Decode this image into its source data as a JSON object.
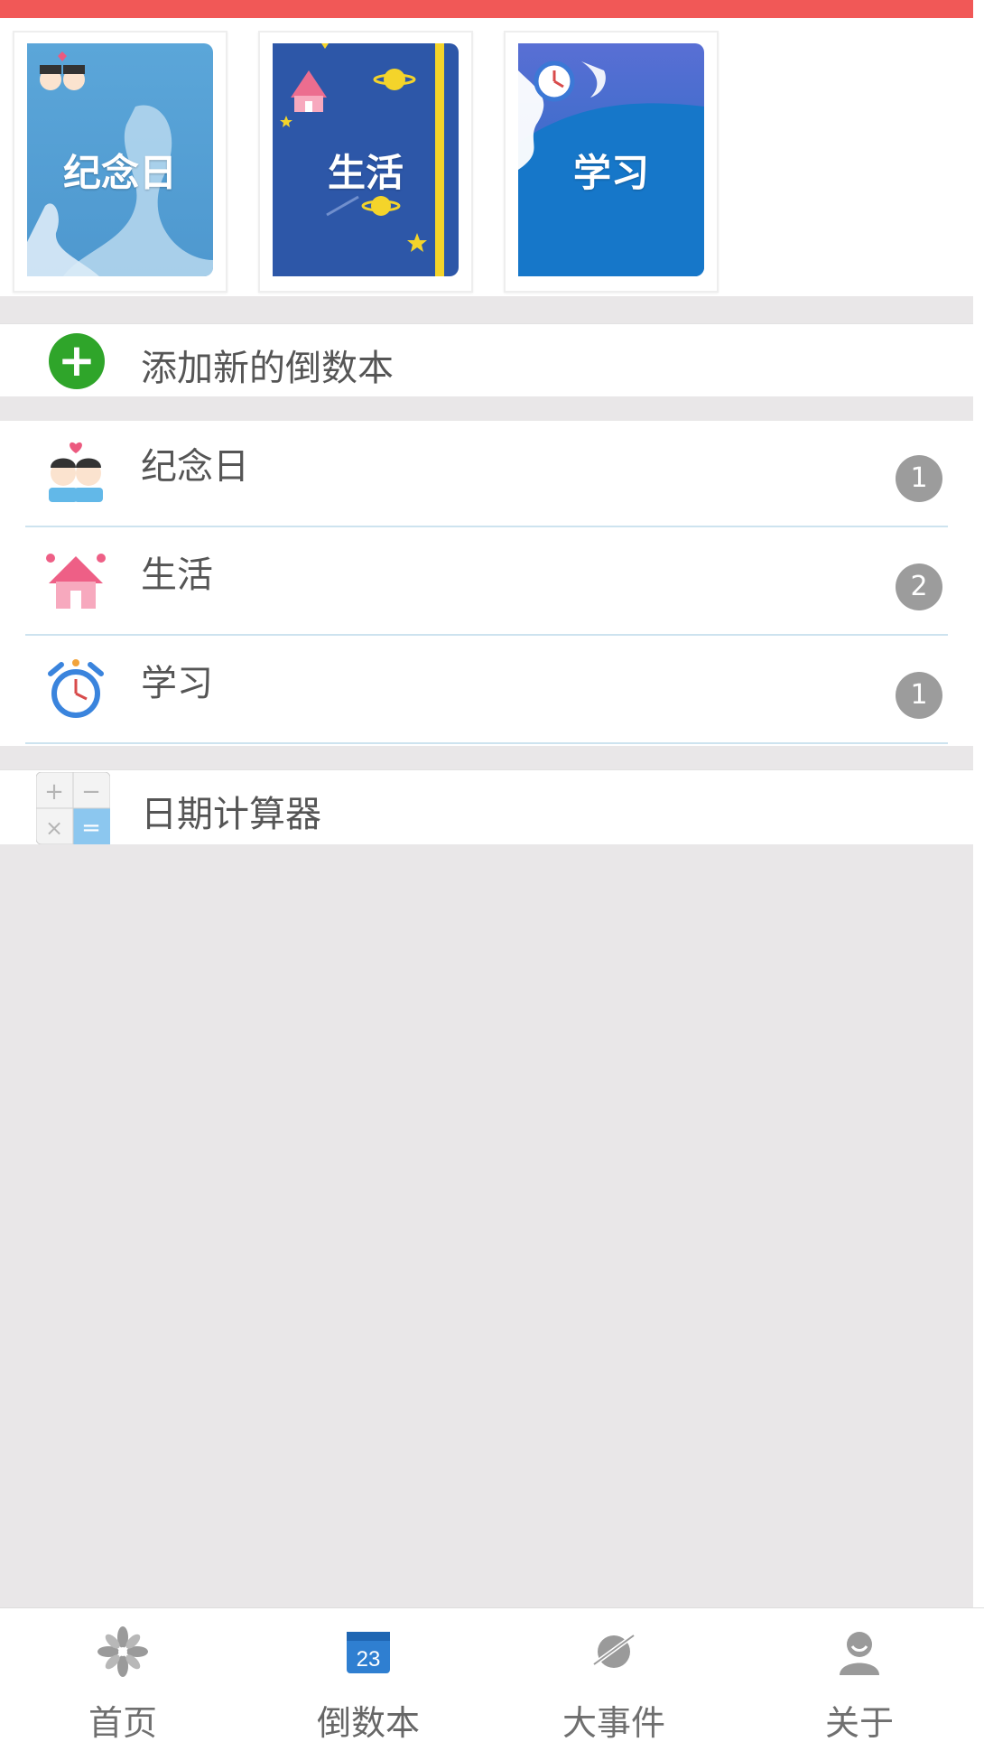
{
  "books": [
    {
      "title": "纪念日"
    },
    {
      "title": "生活"
    },
    {
      "title": "学习"
    }
  ],
  "add_book": {
    "label": "添加新的倒数本"
  },
  "book_list": [
    {
      "label": "纪念日",
      "count": "1",
      "icon": "couple-icon"
    },
    {
      "label": "生活",
      "count": "2",
      "icon": "house-icon"
    },
    {
      "label": "学习",
      "count": "1",
      "icon": "alarm-clock-icon"
    }
  ],
  "date_calculator": {
    "label": "日期计算器"
  },
  "tabs": [
    {
      "label": "首页",
      "icon": "flower-icon"
    },
    {
      "label": "倒数本",
      "icon": "calendar-icon",
      "active": true,
      "icon_text": "23"
    },
    {
      "label": "大事件",
      "icon": "planet-icon"
    },
    {
      "label": "关于",
      "icon": "person-icon"
    }
  ],
  "colors": {
    "accent_bar": "#f15857",
    "add_green": "#2fa52a",
    "badge_gray": "#9c9c9c",
    "active_tab": "#2f7fd1"
  }
}
